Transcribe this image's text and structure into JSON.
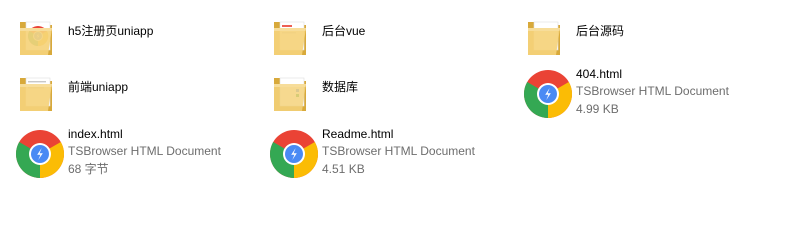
{
  "items": [
    {
      "name": "h5注册页uniapp",
      "type": "folder",
      "badge": "chrome"
    },
    {
      "name": "后台vue",
      "type": "folder",
      "badge": "paper"
    },
    {
      "name": "后台源码",
      "type": "folder",
      "badge": "plain"
    },
    {
      "name": "前端uniapp",
      "type": "folder",
      "badge": "paper"
    },
    {
      "name": "数据库",
      "type": "folder",
      "badge": "document"
    },
    {
      "name": "404.html",
      "type": "file",
      "kind": "TSBrowser HTML Document",
      "size": "4.99 KB"
    },
    {
      "name": "index.html",
      "type": "file",
      "kind": "TSBrowser HTML Document",
      "size": "68 字节"
    },
    {
      "name": "Readme.html",
      "type": "file",
      "kind": "TSBrowser HTML Document",
      "size": "4.51 KB"
    }
  ],
  "colors": {
    "folder_back": "#d8a93a",
    "folder_front": "#f5d27b",
    "folder_front_light": "#f7dd9a",
    "paper": "#ffffff",
    "chrome_red": "#ea4335",
    "chrome_yellow": "#fbbc05",
    "chrome_green": "#34a853",
    "chrome_blue": "#4a8af4",
    "text_primary": "#000000",
    "text_secondary": "#6d6d6d"
  }
}
